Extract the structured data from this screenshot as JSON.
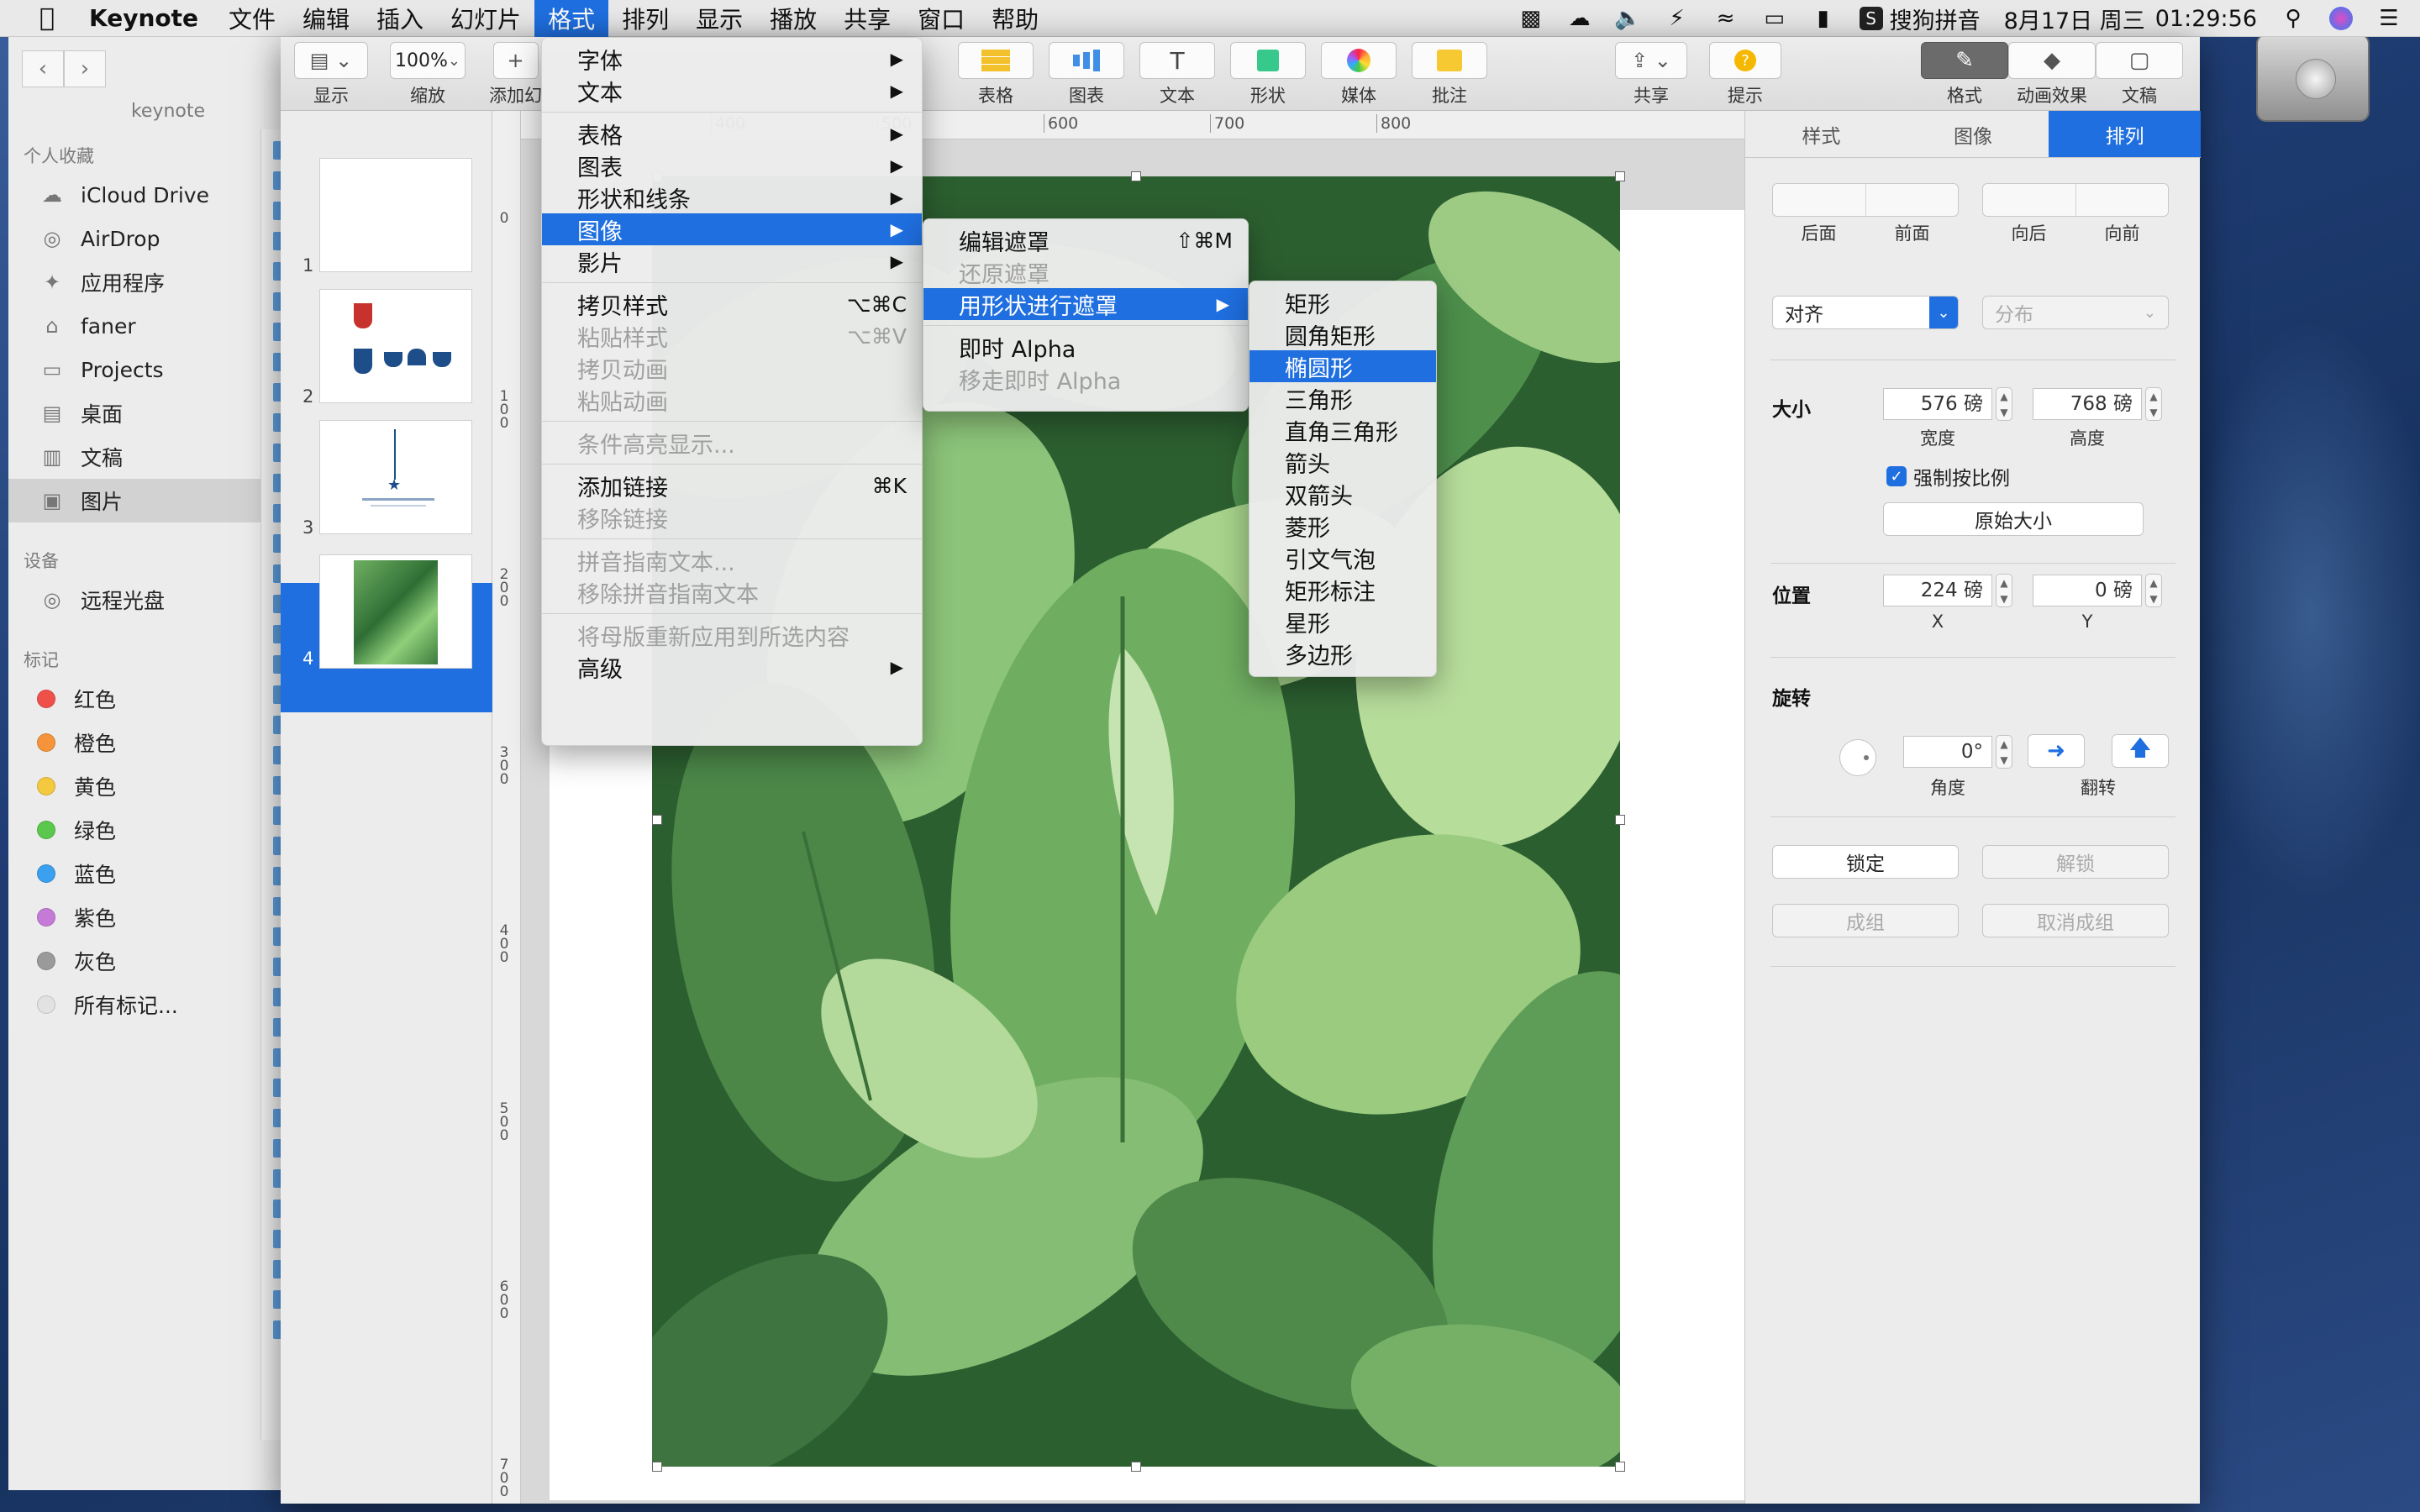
{
  "menubar": {
    "app_name": "Keynote",
    "menus": [
      "文件",
      "编辑",
      "插入",
      "幻灯片",
      "格式",
      "排列",
      "显示",
      "播放",
      "共享",
      "窗口",
      "帮助"
    ],
    "active_menu": "格式",
    "input_method": "搜狗拼音",
    "date": "8月17日 周三",
    "time": "01:29:56"
  },
  "finder": {
    "window_title": "keynote",
    "favorites_header": "个人收藏",
    "favorites": [
      "iCloud Drive",
      "AirDrop",
      "应用程序",
      "faner",
      "Projects",
      "桌面",
      "文稿",
      "图片"
    ],
    "selected_favorite": "图片",
    "devices_header": "设备",
    "devices": [
      "远程光盘"
    ],
    "tags_header": "标记",
    "tags": [
      {
        "label": "红色",
        "color": "#f0504a"
      },
      {
        "label": "橙色",
        "color": "#f5943a"
      },
      {
        "label": "黄色",
        "color": "#f4c83f"
      },
      {
        "label": "绿色",
        "color": "#5ac84c"
      },
      {
        "label": "蓝色",
        "color": "#3aa0ef"
      },
      {
        "label": "紫色",
        "color": "#c57ad8"
      },
      {
        "label": "灰色",
        "color": "#9a9a9a"
      },
      {
        "label": "所有标记...",
        "color": "#e2e2e2"
      }
    ]
  },
  "toolbar": {
    "left": [
      {
        "label": "显示",
        "icon": "sidebar-icon"
      },
      {
        "label": "缩放",
        "value": "100%"
      },
      {
        "label": "添加幻",
        "icon": "plus-icon"
      }
    ],
    "insert": [
      {
        "label": "表格",
        "icon": "table-icon"
      },
      {
        "label": "图表",
        "icon": "chart-icon"
      },
      {
        "label": "文本",
        "icon": "text-icon",
        "glyph": "T"
      },
      {
        "label": "形状",
        "icon": "shape-icon"
      },
      {
        "label": "媒体",
        "icon": "media-icon"
      },
      {
        "label": "批注",
        "icon": "comment-icon"
      }
    ],
    "right": [
      {
        "label": "共享",
        "icon": "share-icon"
      },
      {
        "label": "提示",
        "icon": "tips-icon",
        "glyph": "?"
      }
    ],
    "panels": [
      {
        "label": "格式",
        "icon": "brush-icon"
      },
      {
        "label": "动画效果",
        "icon": "diamond-icon"
      },
      {
        "label": "文稿",
        "icon": "document-icon"
      }
    ]
  },
  "slides": {
    "numbers": [
      "1",
      "2",
      "3",
      "4"
    ],
    "selected": "4"
  },
  "rulers": {
    "top": [
      "400",
      "500",
      "600",
      "700",
      "800"
    ],
    "left": [
      "0",
      "100",
      "200",
      "300",
      "400",
      "500",
      "600",
      "700"
    ]
  },
  "format_menu": {
    "items": [
      {
        "label": "字体",
        "submenu": true
      },
      {
        "label": "文本",
        "submenu": true
      },
      {
        "sep": true
      },
      {
        "label": "表格",
        "submenu": true
      },
      {
        "label": "图表",
        "submenu": true
      },
      {
        "label": "形状和线条",
        "submenu": true
      },
      {
        "label": "图像",
        "submenu": true,
        "highlight": true
      },
      {
        "label": "影片",
        "submenu": true
      },
      {
        "sep": true
      },
      {
        "label": "拷贝样式",
        "shortcut": "⌥⌘C"
      },
      {
        "label": "粘贴样式",
        "shortcut": "⌥⌘V",
        "disabled": true
      },
      {
        "label": "拷贝动画",
        "disabled": true
      },
      {
        "label": "粘贴动画",
        "disabled": true
      },
      {
        "sep": true
      },
      {
        "label": "条件高亮显示...",
        "disabled": true
      },
      {
        "sep": true
      },
      {
        "label": "添加链接",
        "shortcut": "⌘K"
      },
      {
        "label": "移除链接",
        "disabled": true
      },
      {
        "sep": true
      },
      {
        "label": "拼音指南文本...",
        "disabled": true
      },
      {
        "label": "移除拼音指南文本",
        "disabled": true
      },
      {
        "sep": true
      },
      {
        "label": "将母版重新应用到所选内容",
        "disabled": true
      },
      {
        "label": "高级",
        "submenu": true
      }
    ]
  },
  "image_submenu": {
    "items": [
      {
        "label": "编辑遮罩",
        "shortcut": "⇧⌘M"
      },
      {
        "label": "还原遮罩",
        "disabled": true
      },
      {
        "label": "用形状进行遮罩",
        "submenu": true,
        "highlight": true
      },
      {
        "sep": true
      },
      {
        "label": "即时 Alpha"
      },
      {
        "label": "移走即时 Alpha",
        "disabled": true
      }
    ]
  },
  "shape_submenu": {
    "items": [
      {
        "label": "矩形"
      },
      {
        "label": "圆角矩形"
      },
      {
        "label": "椭圆形",
        "highlight": true
      },
      {
        "label": "三角形"
      },
      {
        "label": "直角三角形"
      },
      {
        "label": "箭头"
      },
      {
        "label": "双箭头"
      },
      {
        "label": "菱形"
      },
      {
        "label": "引文气泡"
      },
      {
        "label": "矩形标注"
      },
      {
        "label": "星形"
      },
      {
        "label": "多边形"
      }
    ]
  },
  "inspector": {
    "tabs": [
      "样式",
      "图像",
      "排列"
    ],
    "active_tab": "排列",
    "layer_buttons": [
      "后面",
      "前面",
      "向后",
      "向前"
    ],
    "align_label": "对齐",
    "distribute_label": "分布",
    "size_title": "大小",
    "width": "576 磅",
    "height": "768 磅",
    "width_label": "宽度",
    "height_label": "高度",
    "constrain_label": "强制按比例",
    "constrain_checked": true,
    "original_size": "原始大小",
    "position_title": "位置",
    "x": "224 磅",
    "y": "0 磅",
    "x_label": "X",
    "y_label": "Y",
    "rotate_title": "旋转",
    "angle": "0°",
    "angle_label": "角度",
    "flip_label": "翻转",
    "lock": "锁定",
    "unlock": "解锁",
    "group": "成组",
    "ungroup": "取消成组"
  }
}
